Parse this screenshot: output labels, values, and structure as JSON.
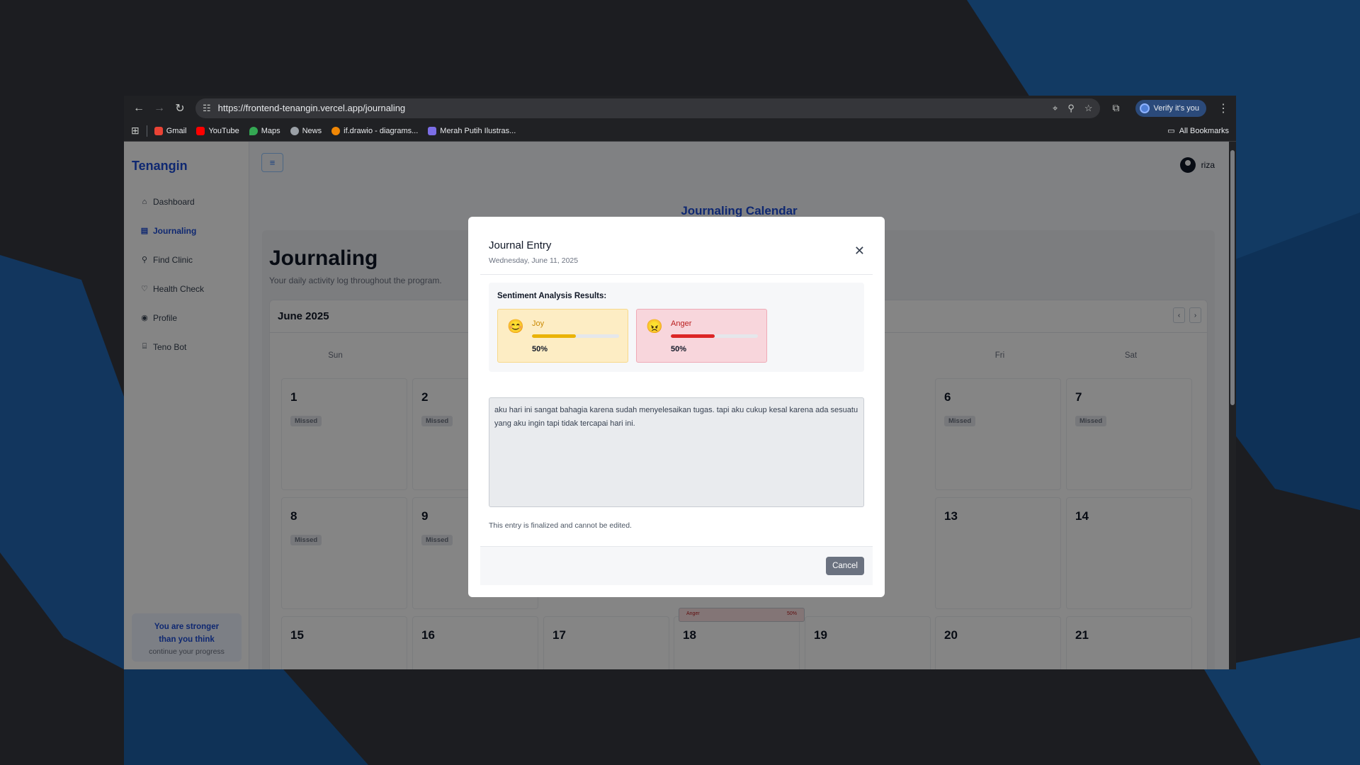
{
  "browser": {
    "url": "https://frontend-tenangin.vercel.app/journaling",
    "verify_label": "Verify it's you",
    "bookmarks": [
      "Gmail",
      "YouTube",
      "Maps",
      "News",
      "if.drawio - diagrams...",
      "Merah Putih Ilustras..."
    ],
    "all_bookmarks": "All Bookmarks"
  },
  "app": {
    "brand": "Tenangin",
    "nav": [
      "Dashboard",
      "Journaling",
      "Find Clinic",
      "Health Check",
      "Profile",
      "Teno Bot"
    ],
    "quote_title": "You are stronger than you think",
    "quote_sub": "continue your progress",
    "user": "riza",
    "calendar_title": "Journaling Calendar",
    "page_title": "Journaling",
    "page_subtitle": "Your daily activity log throughout the program.",
    "month": "June 2025",
    "weekdays": {
      "sun": "Sun",
      "fri": "Fri",
      "sat": "Sat"
    },
    "days": [
      "1",
      "2",
      "6",
      "7",
      "8",
      "9",
      "13",
      "14",
      "15",
      "16",
      "17",
      "18",
      "19",
      "20",
      "21"
    ],
    "missed": "Missed",
    "mini_label": "Anger",
    "mini_pct": "50%"
  },
  "modal": {
    "title": "Journal Entry",
    "date": "Wednesday, June 11, 2025",
    "sentiment_heading": "Sentiment Analysis Results:",
    "emotions": [
      {
        "name": "Joy",
        "percent": "50%",
        "value": 0.5,
        "color": "#eab308"
      },
      {
        "name": "Anger",
        "percent": "50%",
        "value": 0.5,
        "color": "#dc2626"
      }
    ],
    "entry_text": "aku hari ini sangat bahagia karena sudah menyelesaikan tugas. tapi aku cukup kesal karena ada sesuatu yang aku ingin tapi tidak tercapai hari ini.",
    "note": "This entry is finalized and cannot be edited.",
    "cancel_label": "Cancel"
  }
}
